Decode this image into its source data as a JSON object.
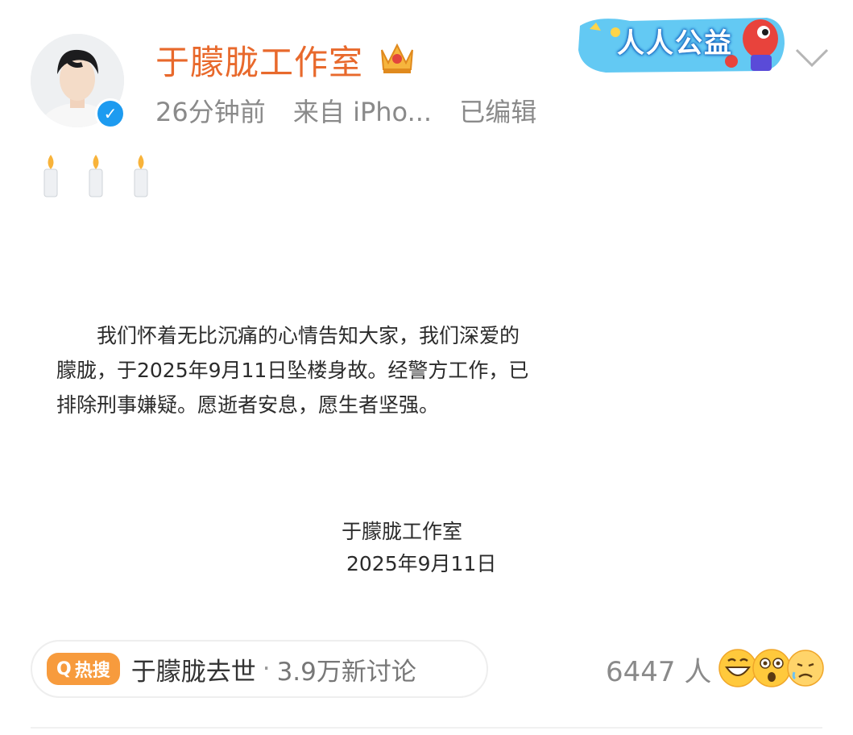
{
  "header": {
    "username": "于朦胧工作室",
    "time": "26分钟前",
    "source": "来自 iPho...",
    "edited": "已编辑",
    "badge_label": "人人公益"
  },
  "post": {
    "candles": [
      "🕯",
      "🕯",
      "🕯"
    ],
    "letter_body": "我们怀着无比沉痛的心情告知大家，我们深爱的朦胧，于2025年9月11日坠楼身故。经警方工作，已排除刑事嫌疑。愿逝者安息，愿生者坚强。",
    "signature_name": "于朦胧工作室",
    "signature_date": "2025年9月11日"
  },
  "hot_search": {
    "badge": "热搜",
    "topic": "于朦胧去世",
    "separator": "·",
    "discussions": "3.9万新讨论"
  },
  "reactions": {
    "count": "6447 人",
    "emojis": [
      "laughing-emoji",
      "shocked-emoji",
      "sad-emoji"
    ]
  },
  "colors": {
    "username": "#e8692c",
    "hot_badge": "#f79b3d",
    "verified": "#1d9bf0"
  }
}
